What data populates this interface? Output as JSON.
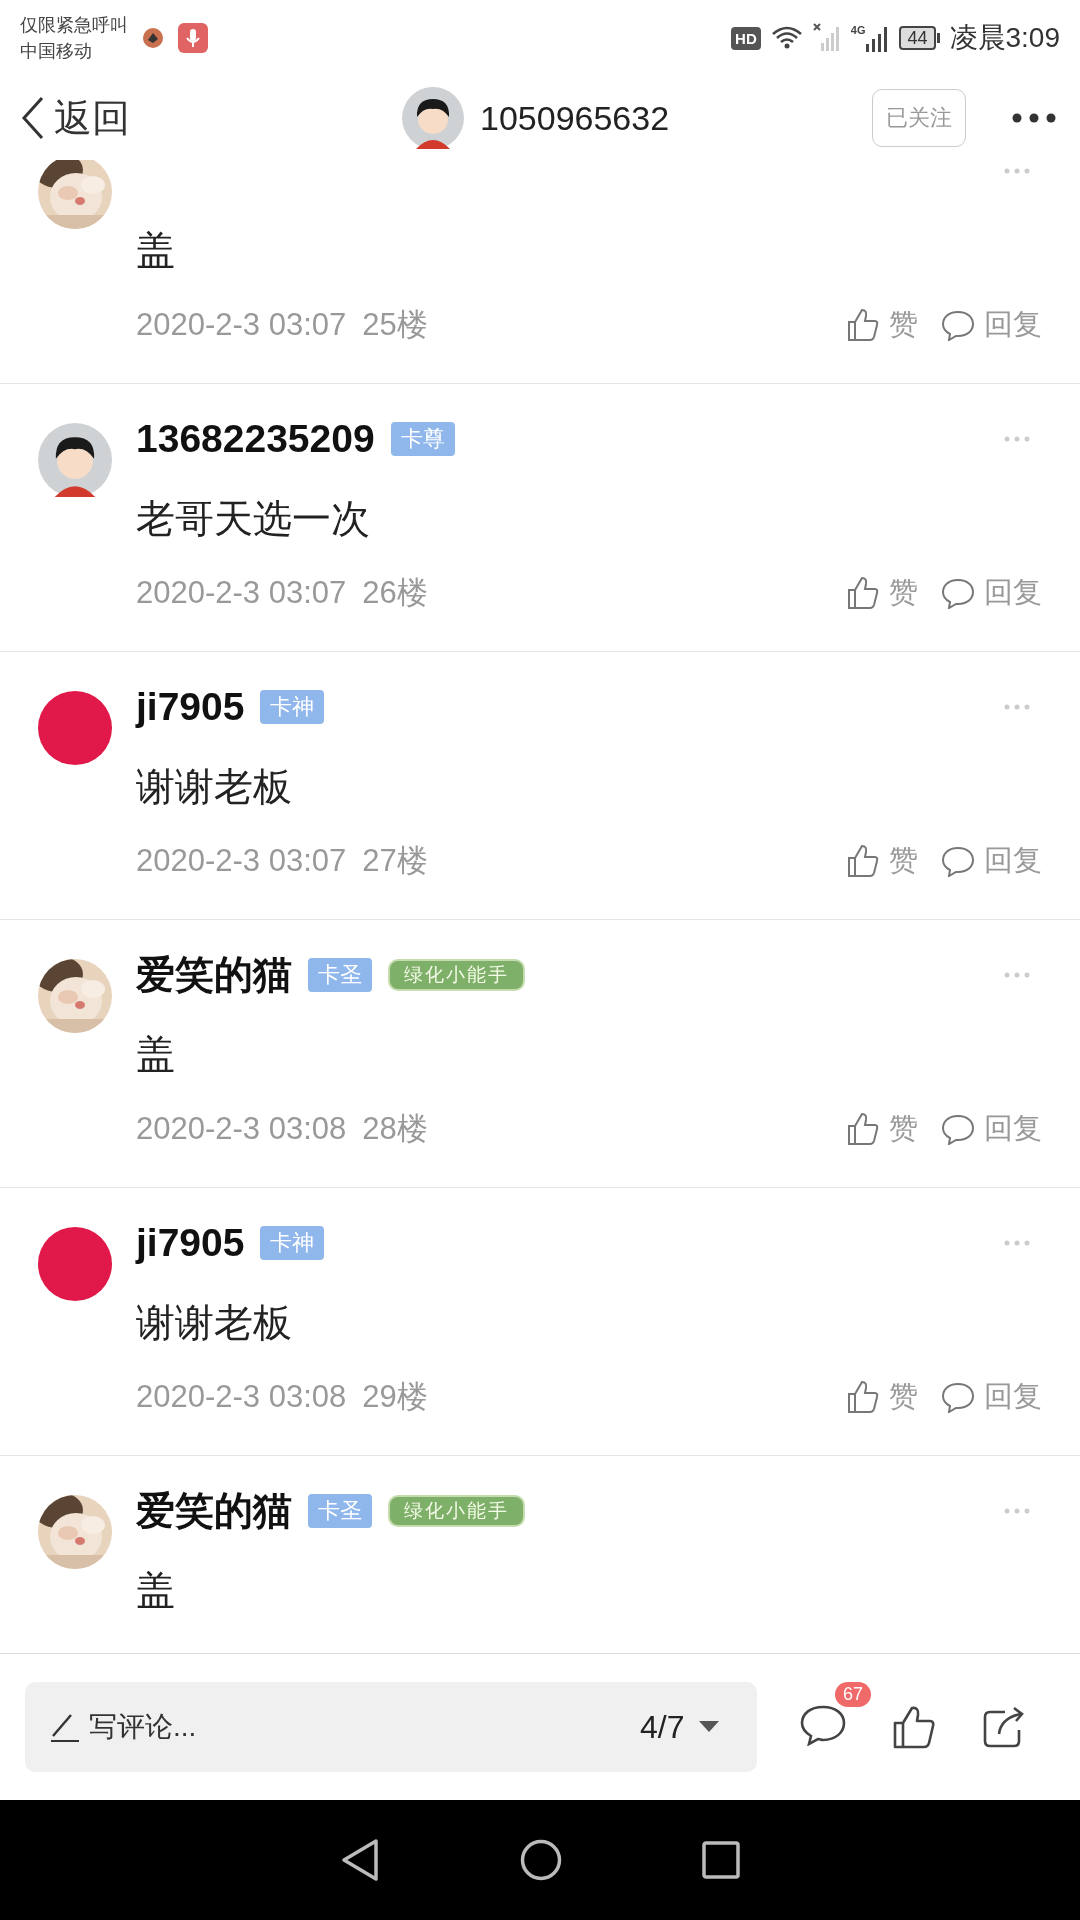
{
  "status_bar": {
    "carrier_note": "仅限紧急呼叫",
    "carrier": "中国移动",
    "hd": "HD",
    "network": "4G",
    "battery": "44",
    "time": "凌晨3:09"
  },
  "header": {
    "back": "返回",
    "username": "1050965632",
    "follow_button": "已关注"
  },
  "comments": [
    {
      "content": "盖",
      "time": "2020-2-3 03:07",
      "floor": "25楼",
      "like": "赞",
      "reply": "回复"
    },
    {
      "avatar": {
        "kind": "cartoon"
      },
      "name": "13682235209",
      "badges": [
        {
          "kind": "rank",
          "text": "卡尊"
        }
      ],
      "content": "老哥天选一次",
      "time": "2020-2-3 03:07",
      "floor": "26楼",
      "like": "赞",
      "reply": "回复"
    },
    {
      "avatar": {
        "kind": "dot",
        "color": "#e0194a"
      },
      "name": "ji7905",
      "badges": [
        {
          "kind": "rank",
          "text": "卡神"
        }
      ],
      "content": "谢谢老板",
      "time": "2020-2-3 03:07",
      "floor": "27楼",
      "like": "赞",
      "reply": "回复"
    },
    {
      "name": "爱笑的猫",
      "badges": [
        {
          "kind": "rank",
          "text": "卡圣"
        },
        {
          "kind": "medal",
          "text": "绿化小能手"
        }
      ],
      "content": "盖",
      "time": "2020-2-3 03:08",
      "floor": "28楼",
      "like": "赞",
      "reply": "回复"
    },
    {
      "avatar": {
        "kind": "dot",
        "color": "#e0194a"
      },
      "name": "ji7905",
      "badges": [
        {
          "kind": "rank",
          "text": "卡神"
        }
      ],
      "content": "谢谢老板",
      "time": "2020-2-3 03:08",
      "floor": "29楼",
      "like": "赞",
      "reply": "回复"
    },
    {
      "name": "爱笑的猫",
      "badges": [
        {
          "kind": "rank",
          "text": "卡圣"
        },
        {
          "kind": "medal",
          "text": "绿化小能手"
        }
      ],
      "content": "盖"
    }
  ],
  "bottom_bar": {
    "placeholder": "写评论...",
    "page": "4/7",
    "comment_count": "67"
  }
}
